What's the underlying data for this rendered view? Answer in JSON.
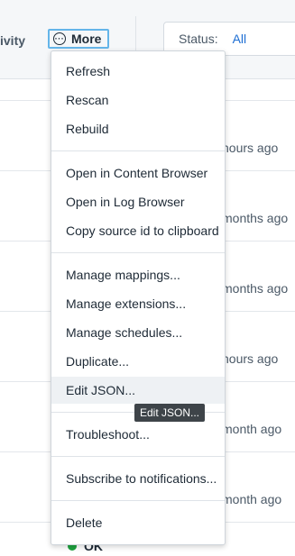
{
  "header": {
    "activity_label": "ivity",
    "more_label": "More",
    "status_label": "Status:",
    "status_value": "All"
  },
  "rows": {
    "times": [
      "hours ago",
      "months ago",
      "months ago",
      "hours ago",
      "month ago",
      "month ago"
    ],
    "last_status": "OK"
  },
  "menu": {
    "group1": [
      "Refresh",
      "Rescan",
      "Rebuild"
    ],
    "group2": [
      "Open in Content Browser",
      "Open in Log Browser",
      "Copy source id to clipboard"
    ],
    "group3": [
      "Manage mappings...",
      "Manage extensions...",
      "Manage schedules...",
      "Duplicate...",
      "Edit JSON..."
    ],
    "group4": [
      "Troubleshoot..."
    ],
    "group5": [
      "Subscribe to notifications..."
    ],
    "group6": [
      "Delete"
    ]
  },
  "tooltip": "Edit JSON...",
  "colors": {
    "accent": "#1d6ed3",
    "focus": "#64b5e9",
    "ok": "#1ea33f"
  }
}
